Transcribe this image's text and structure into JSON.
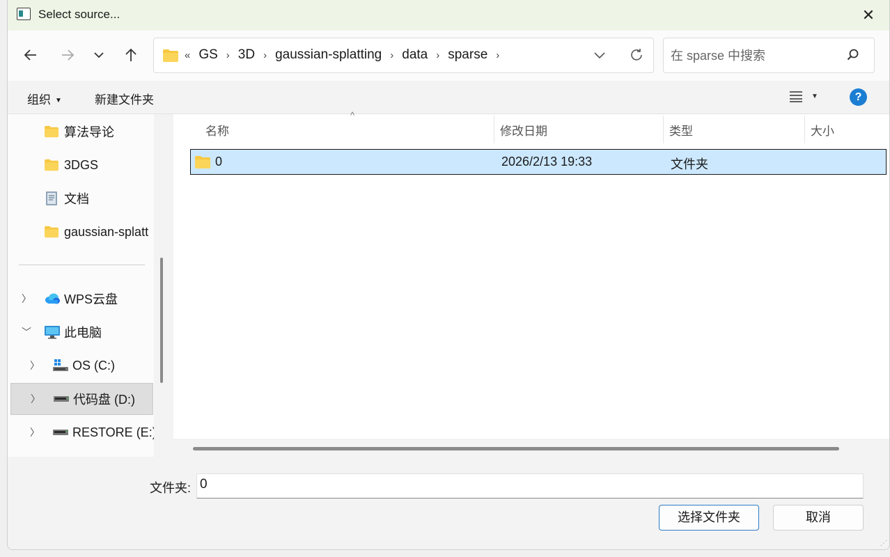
{
  "window": {
    "title": "Select source...",
    "close_glyph": "✕"
  },
  "nav": {
    "back_icon": "back-arrow-icon",
    "forward_icon": "forward-arrow-icon",
    "recent_icon": "chevron-down-icon",
    "up_icon": "up-arrow-icon",
    "overflow": "«",
    "breadcrumbs": [
      "GS",
      "3D",
      "gaussian-splatting",
      "data",
      "sparse"
    ],
    "search_placeholder": "在 sparse 中搜索"
  },
  "toolbar": {
    "organize": "组织",
    "new_folder": "新建文件夹",
    "help": "?"
  },
  "sidebar": {
    "quick_access": [
      {
        "label": "算法导论",
        "icon": "folder-icon"
      },
      {
        "label": "3DGS",
        "icon": "folder-icon"
      },
      {
        "label": "文档",
        "icon": "document-icon"
      },
      {
        "label": "gaussian-splatt",
        "icon": "folder-icon"
      }
    ],
    "wps": {
      "label": "WPS云盘",
      "icon": "cloud-icon"
    },
    "this_pc": {
      "label": "此电脑",
      "icon": "computer-icon"
    },
    "drives": [
      {
        "label": "OS (C:)",
        "icon": "windows-drive-icon"
      },
      {
        "label": "代码盘 (D:)",
        "icon": "drive-icon",
        "selected": true
      },
      {
        "label": "RESTORE (E:)",
        "icon": "drive-icon"
      }
    ]
  },
  "columns": {
    "name": "名称",
    "modified": "修改日期",
    "type": "类型",
    "size": "大小"
  },
  "files": [
    {
      "name": "0",
      "modified": "2026/2/13 19:33",
      "type": "文件夹",
      "size": ""
    }
  ],
  "footer": {
    "folder_label": "文件夹:",
    "folder_value": "0",
    "select_button": "选择文件夹",
    "cancel_button": "取消"
  },
  "colors": {
    "accent": "#1b7ed3",
    "selection": "#cce8ff",
    "titlebar": "#eef5e6",
    "folder": "#f7c843"
  }
}
